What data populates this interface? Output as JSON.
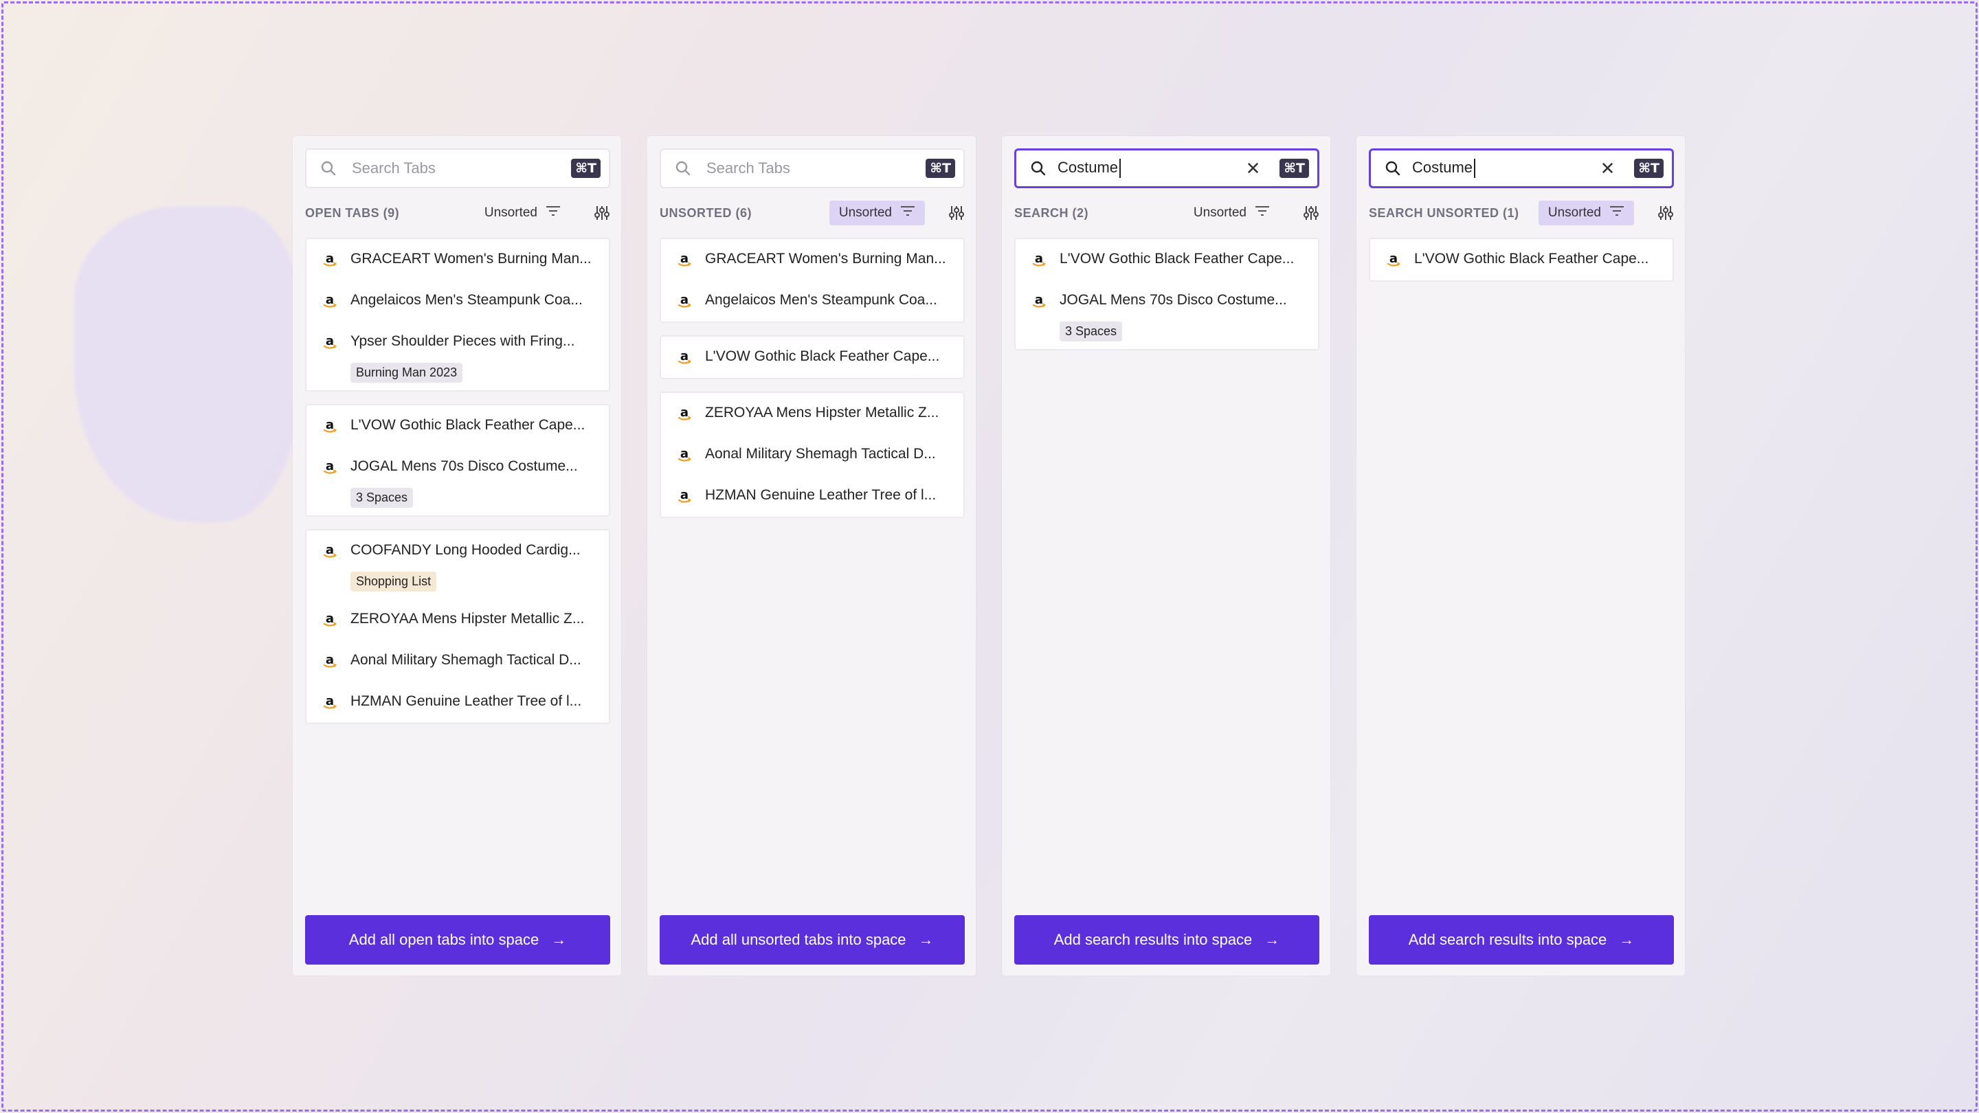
{
  "kbd": "⌘T",
  "clear_glyph": "✕",
  "arrow_glyph": "→",
  "panels": [
    {
      "search": {
        "placeholder": "Search Tabs",
        "value": ""
      },
      "title": "OPEN TABS (9)",
      "sort_label": "Unsorted",
      "sort_highlight": false,
      "groups": [
        {
          "items": [
            {
              "name": "GRACEART Women's Burning Man...",
              "tag": ""
            },
            {
              "name": "Angelaicos Men's Steampunk Coa...",
              "tag": ""
            },
            {
              "name": "Ypser Shoulder Pieces with Fring...",
              "tag": "Burning Man 2023"
            }
          ]
        },
        {
          "items": [
            {
              "name": "L'VOW Gothic Black Feather Cape...",
              "tag": ""
            },
            {
              "name": "JOGAL Mens 70s Disco Costume...",
              "tag": "3 Spaces"
            }
          ]
        },
        {
          "items": [
            {
              "name": "COOFANDY Long Hooded Cardig...",
              "tag": "Shopping List",
              "tag_color": "yellow"
            },
            {
              "name": "ZEROYAA Mens Hipster Metallic Z...",
              "tag": ""
            },
            {
              "name": "Aonal Military Shemagh Tactical D...",
              "tag": ""
            },
            {
              "name": "HZMAN Genuine Leather Tree of l...",
              "tag": ""
            }
          ]
        }
      ],
      "cta": "Add all open tabs into space"
    },
    {
      "search": {
        "placeholder": "Search Tabs",
        "value": ""
      },
      "title": "UNSORTED (6)",
      "sort_label": "Unsorted",
      "sort_highlight": true,
      "groups": [
        {
          "items": [
            {
              "name": "GRACEART Women's Burning Man...",
              "tag": ""
            },
            {
              "name": "Angelaicos Men's Steampunk Coa...",
              "tag": ""
            }
          ]
        },
        {
          "items": [
            {
              "name": "L'VOW Gothic Black Feather Cape...",
              "tag": ""
            }
          ]
        },
        {
          "items": [
            {
              "name": "ZEROYAA Mens Hipster Metallic Z...",
              "tag": ""
            },
            {
              "name": "Aonal Military Shemagh Tactical D...",
              "tag": ""
            },
            {
              "name": "HZMAN Genuine Leather Tree of l...",
              "tag": ""
            }
          ]
        }
      ],
      "cta": "Add all unsorted tabs into space"
    },
    {
      "search": {
        "placeholder": "Search Tabs",
        "value": "Costume"
      },
      "title": "SEARCH (2)",
      "sort_label": "Unsorted",
      "sort_highlight": false,
      "groups": [
        {
          "items": [
            {
              "name": "L'VOW Gothic Black Feather Cape...",
              "tag": ""
            },
            {
              "name": "JOGAL Mens 70s Disco Costume...",
              "tag": "3 Spaces"
            }
          ]
        }
      ],
      "cta": "Add search results into space"
    },
    {
      "search": {
        "placeholder": "Search Tabs",
        "value": "Costume"
      },
      "title": "SEARCH UNSORTED (1)",
      "sort_label": "Unsorted",
      "sort_highlight": true,
      "groups": [
        {
          "items": [
            {
              "name": "L'VOW Gothic Black Feather Cape...",
              "tag": ""
            }
          ]
        }
      ],
      "cta": "Add search results into space"
    }
  ],
  "colors": {
    "accent": "#5b2fdb",
    "focus_border": "#6a3fe0",
    "sort_highlight": "#ddd3f5"
  }
}
